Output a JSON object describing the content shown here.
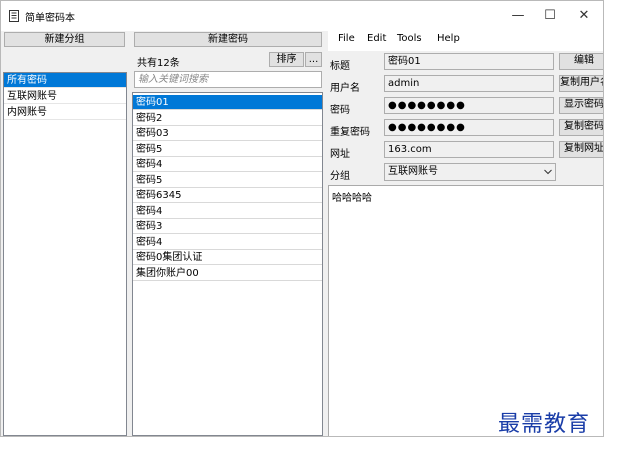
{
  "window": {
    "title": "简单密码本",
    "icon": "notebook-icon"
  },
  "window_controls": {
    "minimize": "—",
    "maximize": "☐",
    "close": "✕"
  },
  "groups": {
    "new_button": "新建分组",
    "items": [
      "所有密码",
      "互联网账号",
      "内网账号"
    ],
    "selected_index": 0
  },
  "passwords": {
    "new_button": "新建密码",
    "count_text": "共有12条",
    "sort_button": "排序",
    "more_button": "...",
    "search_placeholder": "输入关键词搜索",
    "items": [
      "密码01",
      "密码2",
      "密码03",
      "密码5",
      "密码4",
      "密码5",
      "密码6345",
      "密码4",
      "密码3",
      "密码4",
      "密码0集团认证",
      "集团你账户00"
    ],
    "selected_index": 0
  },
  "menu": [
    "File",
    "Edit",
    "Tools",
    "Help"
  ],
  "detail": {
    "title_label": "标题",
    "title_value": "密码01",
    "username_label": "用户名",
    "username_value": "admin",
    "password_label": "密码",
    "password_value": "●●●●●●●●",
    "repeat_label": "重复密码",
    "repeat_value": "●●●●●●●●",
    "url_label": "网址",
    "url_value": "163.com",
    "group_label": "分组",
    "group_value": "互联网账号",
    "notes": "哈哈哈哈",
    "edit_button": "编辑",
    "copy_username_button": "复制用户名",
    "show_button": "显示密码",
    "copy_password_button": "复制密码",
    "copy_url_button": "复制网址"
  },
  "watermark": "最需教育",
  "colors": {
    "selection": "#0078d7",
    "watermark": "#1a3da8"
  }
}
